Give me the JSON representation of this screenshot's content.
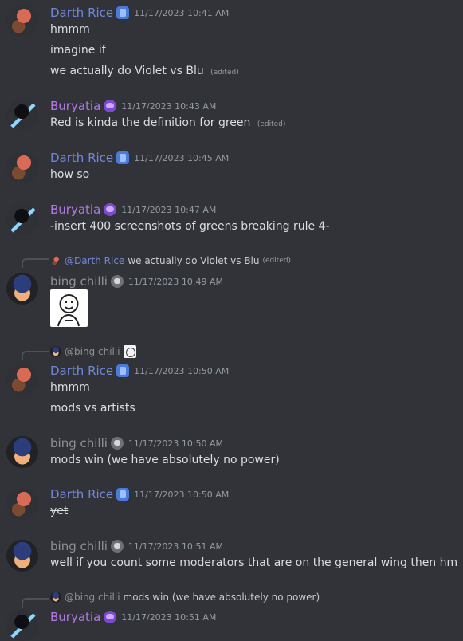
{
  "messages": [
    {
      "author": "Darth Rice",
      "timestamp": "11/17/2023 10:41 AM",
      "lines": [
        {
          "text": "hmmm"
        },
        {
          "text": "imagine if"
        },
        {
          "text": "we actually do Violet vs Blu",
          "edited": "(edited)"
        }
      ],
      "badge_icon": "purple-book-badge-icon",
      "avatar_icon": "soldier-avatar-icon"
    },
    {
      "author": "Buryatia",
      "timestamp": "11/17/2023 10:43 AM",
      "lines": [
        {
          "text": "Red is kinda the definition for green",
          "edited": "(edited)"
        }
      ],
      "badge_icon": "purple-potion-badge-icon",
      "avatar_icon": "blue-flame-avatar-icon"
    },
    {
      "author": "Darth Rice",
      "timestamp": "11/17/2023 10:45 AM",
      "lines": [
        {
          "text": "how so"
        }
      ]
    },
    {
      "author": "Buryatia",
      "timestamp": "11/17/2023 10:47 AM",
      "lines": [
        {
          "text": "-insert 400 screenshots of greens breaking rule 4-"
        }
      ]
    },
    {
      "reply": {
        "mention": "@Darth Rice",
        "text": "we actually do Violet vs Blu",
        "edited": "(edited)"
      },
      "author": "bing chilli",
      "timestamp": "11/17/2023 10:49 AM",
      "sticker_icon": "sticker-meme-icon"
    },
    {
      "reply": {
        "mention": "@bing chilli",
        "text": ""
      },
      "author": "Darth Rice",
      "timestamp": "11/17/2023 10:50 AM",
      "lines": [
        {
          "text": "hmmm"
        },
        {
          "text": "mods vs artists"
        }
      ]
    },
    {
      "author": "bing chilli",
      "timestamp": "11/17/2023 10:50 AM",
      "lines": [
        {
          "text": "mods win (we have absolutely no power)"
        }
      ]
    },
    {
      "author": "Darth Rice",
      "timestamp": "11/17/2023 10:50 AM",
      "lines": [
        {
          "text": "yet",
          "strike": true
        }
      ]
    },
    {
      "author": "bing chilli",
      "timestamp": "11/17/2023 10:51 AM",
      "lines": [
        {
          "text": "well if you count some moderators that are on the general wing then hm"
        }
      ]
    },
    {
      "reply": {
        "mention": "@bing chilli",
        "text": "mods win (we have absolutely no power)"
      },
      "author": "Buryatia",
      "timestamp": "11/17/2023 10:51 AM"
    }
  ]
}
